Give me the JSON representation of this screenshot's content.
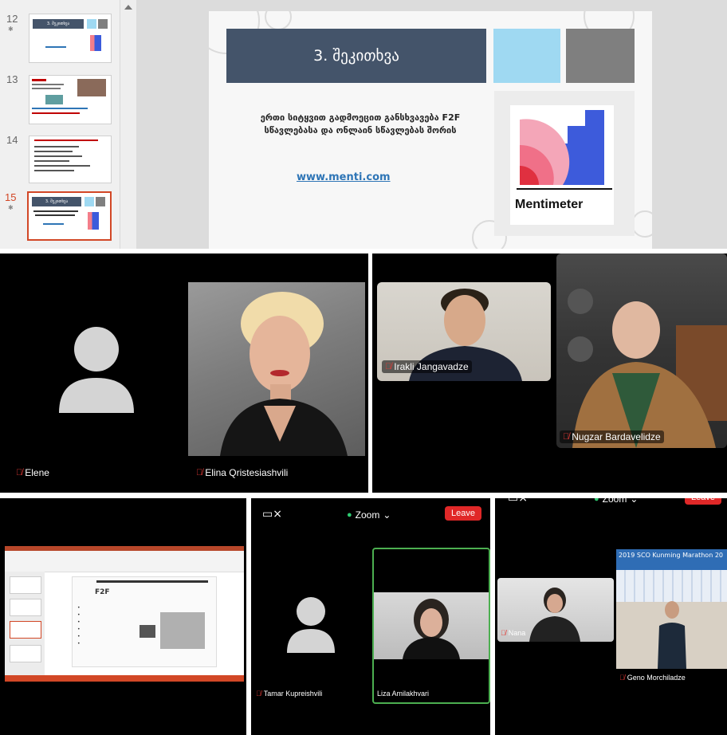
{
  "powerpoint": {
    "thumbnails": [
      {
        "number": "12",
        "title": "3. შეკითხვა"
      },
      {
        "number": "13",
        "title": ""
      },
      {
        "number": "14",
        "title": ""
      },
      {
        "number": "15",
        "title": "3. შეკითხვა",
        "selected": true
      }
    ],
    "slide": {
      "title": "3. შეკითხვა",
      "body_line1": "ერთი სიტყვით გადმოეცით განსხვავება F2F",
      "body_line2": "სწავლებასა და ონლაინ სწავლებას შორის",
      "link": "www.menti.com",
      "logo_text": "Mentimeter",
      "colors": {
        "title_bar": "#44546a",
        "light_blue": "#9fd9f2",
        "gray": "#7f7f7f",
        "link": "#2e75b6"
      }
    }
  },
  "panel_a": {
    "participants": [
      {
        "name": "Elene",
        "muted": true,
        "video": false
      },
      {
        "name": "Elina Qristesiashvili",
        "muted": true,
        "video": true
      }
    ]
  },
  "panel_b": {
    "participants": [
      {
        "name": "Irakli Jangavadze",
        "muted": true,
        "video": true
      },
      {
        "name": "Nugzar Bardavelidze",
        "muted": true,
        "video": true
      }
    ]
  },
  "panel_c": {
    "shared_slide_heading": "F2F",
    "shared_bullets": [
      "• ",
      "• ",
      "• ",
      "• ",
      "• ",
      "• "
    ]
  },
  "panel_d": {
    "zoom_label": "Zoom",
    "leave_label": "Leave",
    "participants": [
      {
        "name": "Tamar Kupreishvili",
        "muted": true,
        "video": false
      },
      {
        "name": "Liza Amilakhvari",
        "muted": false,
        "video": true,
        "active_speaker": true
      }
    ]
  },
  "panel_e": {
    "zoom_label": "Zoom",
    "leave_label": "Leave",
    "banner_text": "2019 SCO Kunming Marathon 20",
    "participants": [
      {
        "name": "Nana",
        "muted": true,
        "video": true
      },
      {
        "name": "Geno Morchiladze",
        "muted": true,
        "video": true
      }
    ]
  },
  "icons": [
    "microphone-muted-icon",
    "camera-off-icon",
    "shield-check-icon",
    "chevron-down-icon",
    "user-placeholder-icon",
    "star-icon"
  ]
}
